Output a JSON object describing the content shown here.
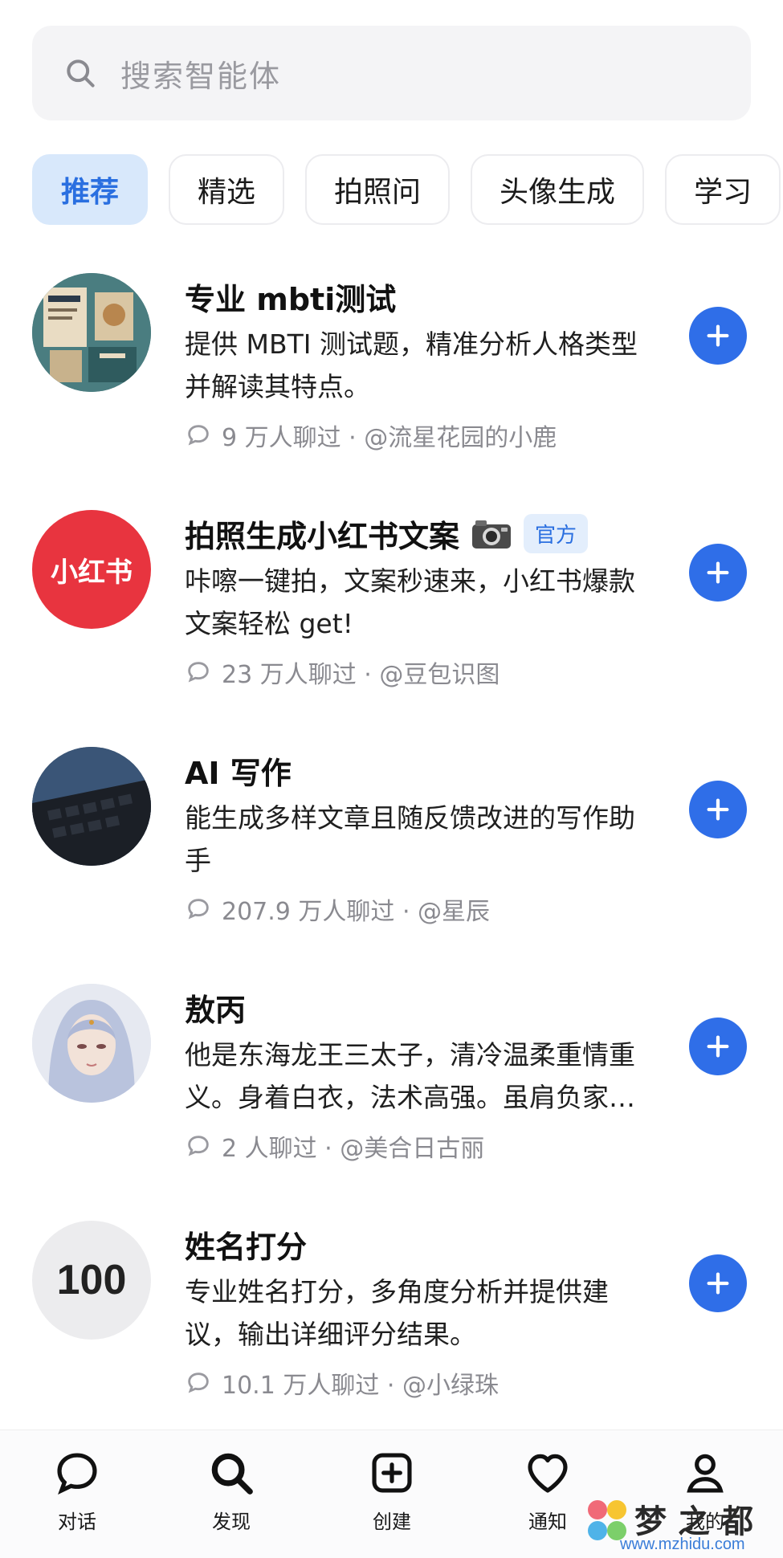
{
  "search": {
    "placeholder": "搜索智能体"
  },
  "tabs": [
    {
      "label": "推荐",
      "active": true
    },
    {
      "label": "精选"
    },
    {
      "label": "拍照问"
    },
    {
      "label": "头像生成"
    },
    {
      "label": "学习"
    }
  ],
  "agents": [
    {
      "title": "专业 mbti测试",
      "desc": "提供 MBTI 测试题，精准分析人格类型并解读其特点。",
      "stats": "9 万人聊过 · @流星花园的小鹿",
      "avatar": "mbti-avatar"
    },
    {
      "title": "拍照生成小红书文案",
      "badge": "官方",
      "desc": "咔嚓一键拍，文案秒速来，小红书爆款文案轻松 get!",
      "stats": "23 万人聊过 · @豆包识图",
      "avatar": "xiaohongshu-avatar",
      "avatar_text": "小红书"
    },
    {
      "title": "AI 写作",
      "desc": "能生成多样文章且随反馈改进的写作助手",
      "stats": "207.9 万人聊过 · @星辰",
      "avatar": "keyboard-avatar"
    },
    {
      "title": "敖丙",
      "desc": "他是东海龙王三太子，清冷温柔重情重义。身着白衣，法术高强。虽肩负家…",
      "stats": "2 人聊过 · @美合日古丽",
      "avatar": "character-avatar"
    },
    {
      "title": "姓名打分",
      "desc": "专业姓名打分，多角度分析并提供建议，输出详细评分结果。",
      "stats": "10.1 万人聊过 · @小绿珠",
      "avatar": "score-avatar",
      "avatar_text": "100"
    }
  ],
  "nav": [
    {
      "label": "对话",
      "icon": "chat-icon"
    },
    {
      "label": "发现",
      "icon": "search-icon"
    },
    {
      "label": "创建",
      "icon": "plus-square-icon"
    },
    {
      "label": "通知",
      "icon": "heart-icon"
    },
    {
      "label": "我的",
      "icon": "user-icon"
    }
  ],
  "watermark": {
    "text": "梦之都",
    "url": "www.mzhidu.com"
  },
  "colors": {
    "accent": "#2f6ee8",
    "tab_active_bg": "#d8e8fb",
    "muted": "#8a8a90"
  }
}
